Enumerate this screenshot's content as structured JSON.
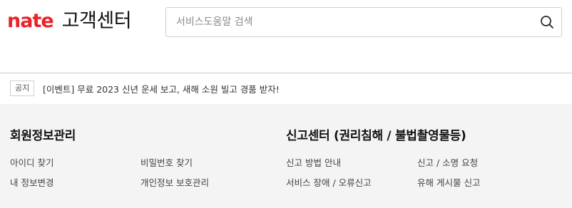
{
  "header": {
    "logo_brand": "nate",
    "logo_title": "고객센터",
    "search": {
      "placeholder": "서비스도움말 검색",
      "value": "",
      "button_icon": "search-icon"
    }
  },
  "notice": {
    "badge": "공지",
    "text": "[이벤트] 무료 2023 신년 운세 보고, 새해 소원 빌고 경품 받자!"
  },
  "sections": [
    {
      "title": "회원정보관리",
      "links": [
        "아이디 찾기",
        "비밀번호 찾기",
        "내 정보변경",
        "개인정보 보호관리"
      ]
    },
    {
      "title": "신고센터 (권리침해 / 불법촬영물등)",
      "links": [
        "신고 방법 안내",
        "신고 / 소명 요청",
        "서비스 장애 / 오류신고",
        "유해 게시물 신고"
      ]
    }
  ],
  "colors": {
    "brand": "#e8242a",
    "panel_bg": "#f4f4f4",
    "border": "#c9c9c9"
  }
}
